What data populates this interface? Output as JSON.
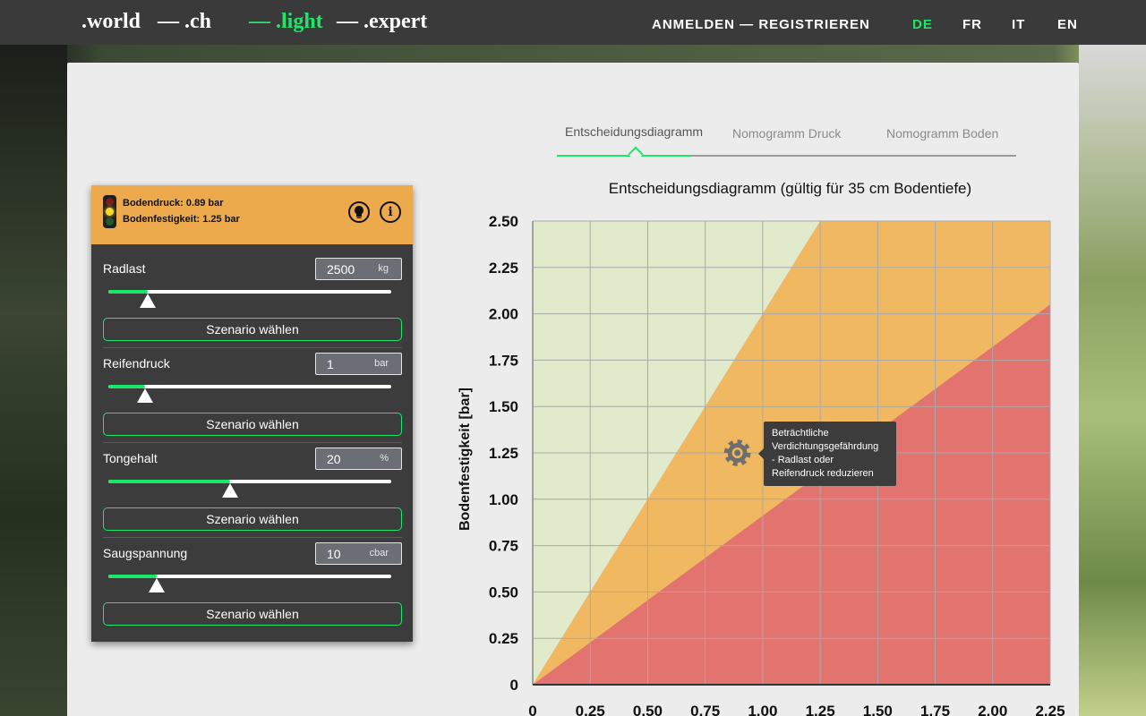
{
  "nav": {
    "brands": [
      ".world",
      "— .ch",
      "— .light",
      "— .expert"
    ],
    "login": "ANMELDEN",
    "auth_sep": "—",
    "register": "REGISTRIEREN",
    "languages": [
      "DE",
      "FR",
      "IT",
      "EN"
    ],
    "active_language": "DE",
    "active_color": "#1ee66a"
  },
  "panel": {
    "header_bg": "#ecaa4d",
    "status_icon": "traffic-light-icon",
    "bodendruck_label": "Bodendruck:",
    "bodendruck_value": "0.89 bar",
    "bodenfestigkeit_label": "Bodenfestigkeit:",
    "bodenfestigkeit_value": "1.25 bar",
    "controls": [
      {
        "label": "Radlast",
        "value": "2500",
        "unit": "kg",
        "slider_fraction": 0.14,
        "button": "Szenario wählen"
      },
      {
        "label": "Reifendruck",
        "value": "1",
        "unit": "bar",
        "slider_fraction": 0.13,
        "button": "Szenario wählen"
      },
      {
        "label": "Tongehalt",
        "value": "20",
        "unit": "%",
        "slider_fraction": 0.43,
        "button": "Szenario wählen"
      },
      {
        "label": "Saugspannung",
        "value": "10",
        "unit": "cbar",
        "slider_fraction": 0.17,
        "button": "Szenario wählen"
      }
    ]
  },
  "tabs": [
    "Entscheidungsdiagramm",
    "Nomogramm Druck",
    "Nomogramm Boden"
  ],
  "tooltip": {
    "lines": [
      "Beträchtliche",
      "Verdichtungsgefährdung",
      "- Radlast oder",
      "Reifendruck reduzieren"
    ]
  },
  "chart_data": {
    "type": "area",
    "title": "Entscheidungsdiagramm (gültig für 35 cm Bodentiefe)",
    "xlabel": "",
    "ylabel": "Bodenfestigkeit [bar]",
    "xlim": [
      0,
      2.25
    ],
    "ylim": [
      0,
      2.5
    ],
    "x_ticks": [
      "0",
      "0.25",
      "0.50",
      "0.75",
      "1.00",
      "1.25",
      "1.50",
      "1.75",
      "2.00",
      "2.25"
    ],
    "y_ticks": [
      "0",
      "0.25",
      "0.50",
      "0.75",
      "1.00",
      "1.25",
      "1.50",
      "1.75",
      "2.00",
      "2.25",
      "2.50"
    ],
    "grid": true,
    "regions": [
      {
        "color": "#e1eacb",
        "boundary": [
          [
            0,
            0
          ],
          [
            1.25,
            2.5
          ]
        ]
      },
      {
        "color": "#f1b862",
        "boundary": [
          [
            0,
            0
          ],
          [
            2.25,
            2.05
          ]
        ]
      },
      {
        "color": "#e2736e"
      }
    ],
    "current_point": {
      "x": 0.89,
      "y": 1.25,
      "icon": "gear-icon"
    }
  }
}
